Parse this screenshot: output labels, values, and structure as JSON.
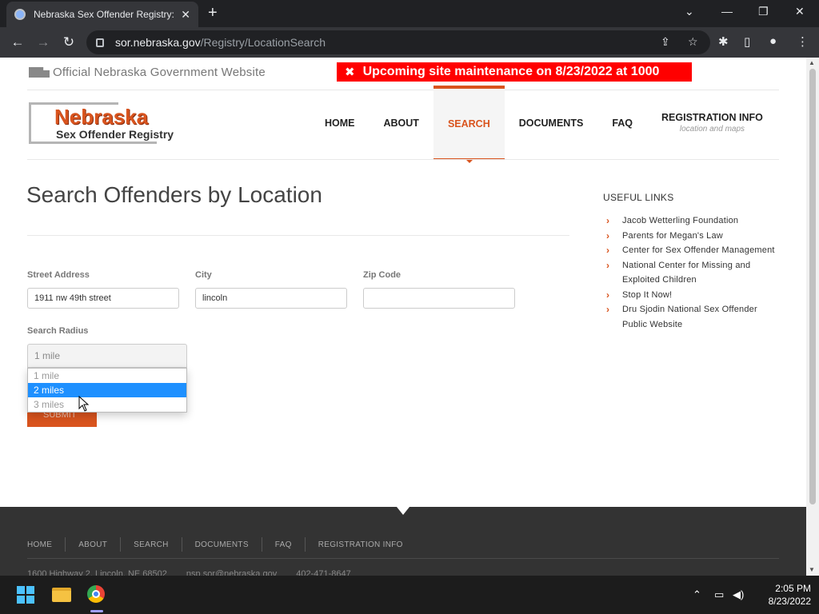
{
  "browser": {
    "tab_title": "Nebraska Sex Offender Registry:",
    "tab_close": "✕",
    "new_tab": "+",
    "url_host": "sor.nebraska.gov",
    "url_path": "/Registry/LocationSearch",
    "icon_back": "←",
    "icon_forward": "→",
    "icon_reload": "↻",
    "icon_share": "⇪",
    "icon_star": "☆",
    "icon_ext": "✱",
    "icon_sidepanel": "▯",
    "icon_profile": "●",
    "icon_menu": "⋮",
    "win_dropdown": "⌄",
    "win_min": "—",
    "win_restore": "❐",
    "win_close": "✕"
  },
  "banner": {
    "official": "Official Nebraska Government Website",
    "maintenance": "Upcoming site maintenance on 8/23/2022 at 1000",
    "tool_icon": "✖"
  },
  "logo": {
    "name": "Nebraska",
    "subtitle": "Sex Offender Registry"
  },
  "nav": {
    "items": [
      {
        "label": "HOME",
        "sub": ""
      },
      {
        "label": "ABOUT",
        "sub": ""
      },
      {
        "label": "SEARCH",
        "sub": ""
      },
      {
        "label": "DOCUMENTS",
        "sub": ""
      },
      {
        "label": "FAQ",
        "sub": ""
      },
      {
        "label": "REGISTRATION INFO",
        "sub": "location and maps"
      }
    ],
    "active": "SEARCH"
  },
  "main": {
    "title": "Search Offenders by Location",
    "street_label": "Street Address",
    "street_value": "1911 nw 49th street",
    "city_label": "City",
    "city_value": "lincoln",
    "zip_label": "Zip Code",
    "zip_value": "",
    "radius_label": "Search Radius",
    "radius_selected": "1 mile",
    "radius_options": [
      "1 mile",
      "2 miles",
      "3 miles"
    ],
    "radius_highlighted": "2 miles",
    "submit_label": "SUBMIT"
  },
  "sidebar": {
    "heading": "USEFUL LINKS",
    "chevron": "›",
    "links": [
      "Jacob Wetterling Foundation",
      "Parents for Megan's Law",
      "Center for Sex Offender Management",
      "National Center for Missing and Exploited Children",
      "Stop It Now!",
      "Dru Sjodin National Sex Offender Public Website"
    ]
  },
  "footer": {
    "nav": [
      "HOME",
      "ABOUT",
      "SEARCH",
      "DOCUMENTS",
      "FAQ",
      "REGISTRATION INFO"
    ],
    "address": "1600 Highway 2, Lincoln, NE 68502",
    "email": "nsp.sor@nebraska.gov",
    "phone": "402-471-8647"
  },
  "taskbar": {
    "time": "2:05 PM",
    "date": "8/23/2022",
    "tray_chevron": "⌃",
    "tray_network": "▭",
    "tray_volume": "◀)"
  },
  "colors": {
    "accent": "#d9541e",
    "maintenance_bg": "#ff0000",
    "highlight": "#1e90ff",
    "footer_bg": "#333333"
  }
}
